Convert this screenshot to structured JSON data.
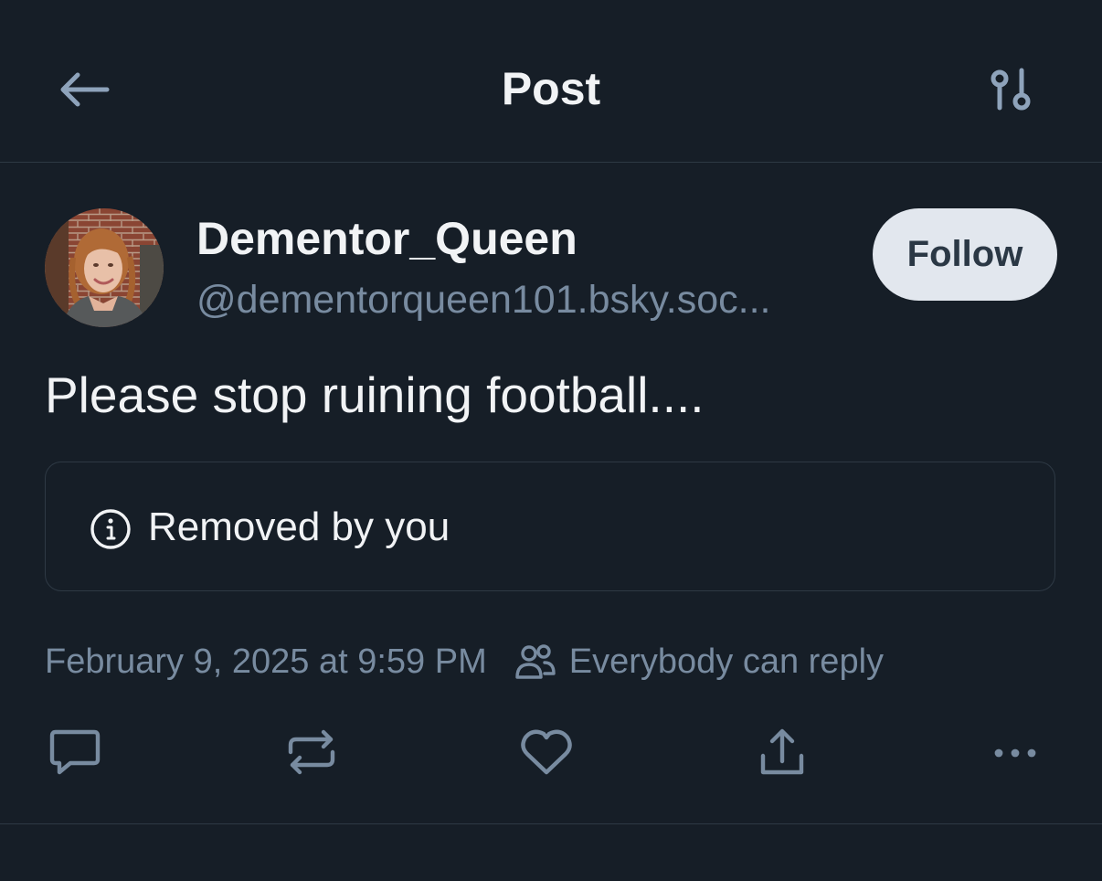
{
  "header": {
    "title": "Post",
    "back_icon": "arrow-left-icon",
    "settings_icon": "sliders-icon"
  },
  "post": {
    "author": {
      "display_name": "Dementor_Queen",
      "handle": "@dementorqueen101.bsky.soc..."
    },
    "follow_label": "Follow",
    "text": "Please stop ruining football....",
    "notice": {
      "icon": "info-icon",
      "text": "Removed by you"
    },
    "timestamp": "February 9, 2025 at 9:59 PM",
    "reply_setting": {
      "icon": "people-icon",
      "text": "Everybody can reply"
    },
    "actions": [
      "reply-icon",
      "repost-icon",
      "like-icon",
      "share-icon",
      "more-icon"
    ]
  },
  "colors": {
    "background": "#161e27",
    "primary_text": "#f1f3f5",
    "secondary_text": "#788ba0",
    "border": "#2e3944",
    "follow_bg": "#e2e7ee",
    "follow_text": "#2b3845"
  }
}
